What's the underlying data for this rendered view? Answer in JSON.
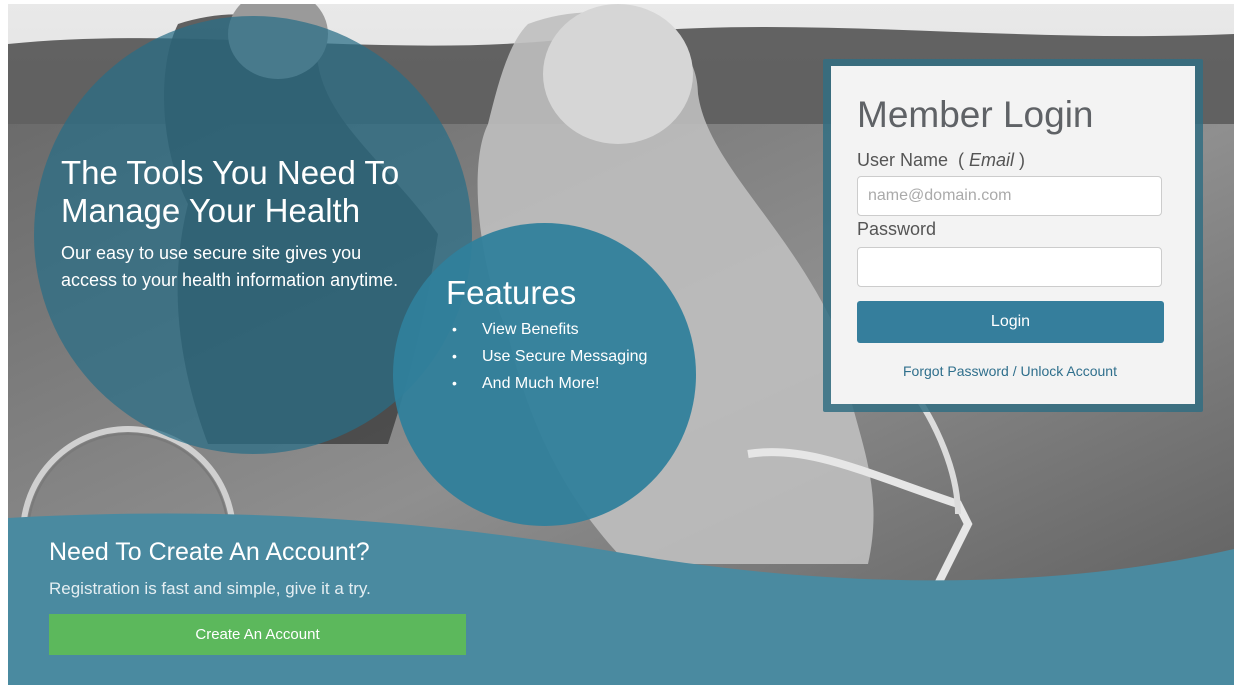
{
  "hero": {
    "title": "The Tools You Need To Manage Your Health",
    "text": "Our easy to use secure site gives you access to your health information anytime."
  },
  "features": {
    "title": "Features",
    "items": [
      "View Benefits",
      "Use Secure Messaging",
      "And Much More!"
    ]
  },
  "login": {
    "title": "Member Login",
    "username_label": "User Name",
    "username_hint": "Email",
    "username_placeholder": "name@domain.com",
    "username_value": "",
    "password_label": "Password",
    "password_value": "",
    "login_button": "Login",
    "forgot_link": "Forgot Password / Unlock Account"
  },
  "registration": {
    "title": "Need To Create An Account?",
    "text": "Registration is fast and simple, give it a try.",
    "button": "Create An Account"
  },
  "colors": {
    "primary": "#357e9c",
    "success": "#5cb85c",
    "wave": "#4a8aa0",
    "card": "#f3f3f3"
  }
}
